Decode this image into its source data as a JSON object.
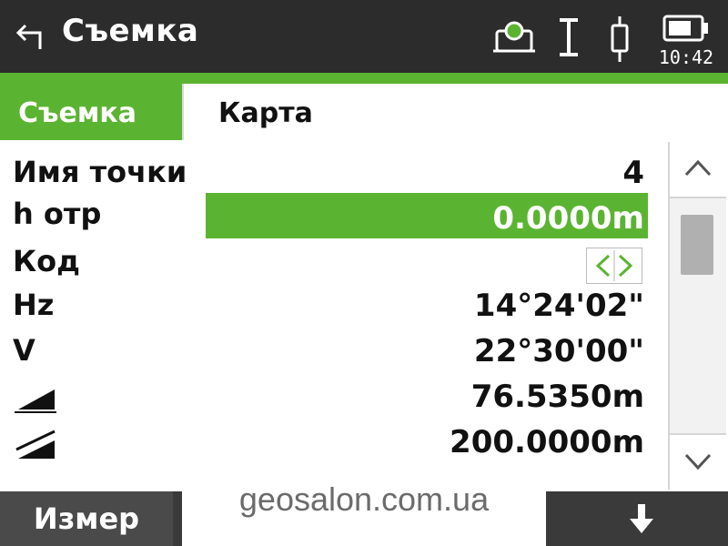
{
  "header": {
    "title": "Съемка",
    "time": "10:42",
    "icons": [
      "back-arrow-icon",
      "prism-target-icon",
      "text-cursor-icon",
      "reflector-prism-icon",
      "battery-icon"
    ]
  },
  "tabs": [
    {
      "label": "Съемка",
      "active": true
    },
    {
      "label": "Карта",
      "active": false
    }
  ],
  "fields": [
    {
      "label": "Имя точки",
      "value": "4"
    },
    {
      "label": "h отр",
      "value": "0.0000m"
    },
    {
      "label": "Код",
      "value": ""
    },
    {
      "label": "Hz",
      "value": "14°24'02\""
    },
    {
      "label": "V",
      "value": "22°30'00\""
    },
    {
      "label_icon": "slope-distance-icon",
      "value": "76.5350m"
    },
    {
      "label_icon": "horizontal-distance-icon",
      "value": "200.0000m"
    }
  ],
  "softkeys": {
    "key1": "Измер",
    "down_icon": "arrow-down-icon"
  },
  "watermark": "geosalon.com.ua",
  "colors": {
    "accent": "#5bb431",
    "header_bg": "#2c2c2c"
  }
}
